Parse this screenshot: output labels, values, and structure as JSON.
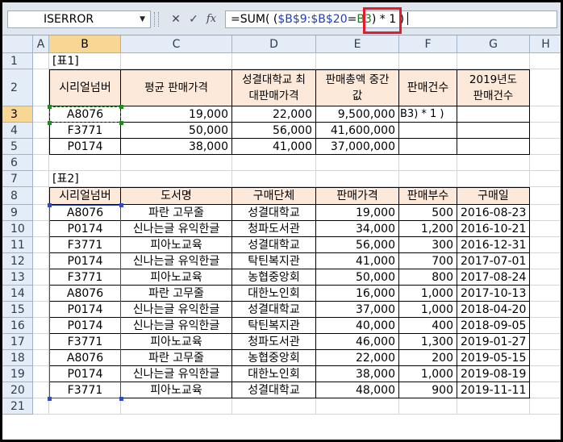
{
  "formula_bar": {
    "name_box": "ISERROR",
    "fx_label": "fx",
    "cancel_glyph": "✕",
    "enter_glyph": "✓",
    "formula_parts": [
      {
        "text": "=SUM( (",
        "cls": ""
      },
      {
        "text": "$B$9:$B$20",
        "cls": "ref"
      },
      {
        "text": "=",
        "cls": ""
      },
      {
        "text": "B3",
        "cls": "ref2"
      },
      {
        "text": ") * 1 )",
        "cls": ""
      }
    ]
  },
  "columns": [
    "A",
    "B",
    "C",
    "D",
    "E",
    "F",
    "G",
    "H"
  ],
  "rows": [
    "1",
    "2",
    "3",
    "4",
    "5",
    "6",
    "7",
    "8",
    "9",
    "10",
    "11",
    "12",
    "13",
    "14",
    "15",
    "16",
    "17",
    "18",
    "19",
    "20",
    "21"
  ],
  "table1": {
    "label": "[표1]",
    "headers": [
      "시리얼넘버",
      "평균 판매가격",
      "성결대학교 최대판매가격",
      "판매총액 중간값",
      "판매건수",
      "2019년도 판매건수"
    ],
    "rows": [
      [
        "A8076",
        "19,000",
        "22,000",
        "9,500,000"
      ],
      [
        "F3771",
        "50,000",
        "56,000",
        "41,600,000"
      ],
      [
        "P0174",
        "38,000",
        "41,000",
        "37,000,000"
      ]
    ],
    "editing_text": "B3) * 1 )"
  },
  "table2": {
    "label": "[표2]",
    "headers": [
      "시리얼넘버",
      "도서명",
      "구매단체",
      "판매가격",
      "판매부수",
      "구매일"
    ],
    "rows": [
      [
        "A8076",
        "파란 고무줄",
        "성결대학교",
        "19,000",
        "500",
        "2016-08-23"
      ],
      [
        "P0174",
        "신나는글 유익한글",
        "청파도서관",
        "34,000",
        "1,200",
        "2016-10-21"
      ],
      [
        "F3771",
        "피아노교육",
        "성결대학교",
        "56,000",
        "300",
        "2016-12-31"
      ],
      [
        "P0174",
        "신나는글 유익한글",
        "탁틴복지관",
        "41,000",
        "700",
        "2017-07-01"
      ],
      [
        "F3771",
        "피아노교육",
        "농협중앙회",
        "50,000",
        "800",
        "2017-08-24"
      ],
      [
        "A8076",
        "파란 고무줄",
        "대한노인회",
        "16,000",
        "1,000",
        "2017-10-13"
      ],
      [
        "P0174",
        "신나는글 유익한글",
        "성결대학교",
        "37,000",
        "1,000",
        "2018-04-20"
      ],
      [
        "P0174",
        "신나는글 유익한글",
        "탁틴복지관",
        "40,000",
        "400",
        "2018-09-05"
      ],
      [
        "F3771",
        "피아노교육",
        "청파도서관",
        "46,000",
        "1,300",
        "2019-01-27"
      ],
      [
        "A8076",
        "파란 고무줄",
        "농협중앙회",
        "22,000",
        "200",
        "2019-05-15"
      ],
      [
        "P0174",
        "신나는글 유익한글",
        "대한노인회",
        "38,000",
        "1,000",
        "2019-08-19"
      ],
      [
        "F3771",
        "피아노교육",
        "성결대학교",
        "48,000",
        "900",
        "2019-11-11"
      ]
    ]
  },
  "colors": {
    "header_fill": "#fde9d9",
    "highlight_box": "#e8192c",
    "range_ref": "#1f3fb5",
    "cell_ref": "#1a7a1a"
  }
}
